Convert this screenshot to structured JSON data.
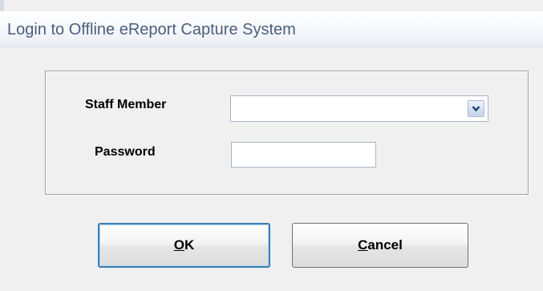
{
  "window": {
    "title": "Login to Offline eReport Capture System"
  },
  "form": {
    "staff_label": "Staff Member",
    "staff_value": "",
    "password_label": "Password",
    "password_value": ""
  },
  "buttons": {
    "ok": {
      "mnemonic": "O",
      "rest": "K"
    },
    "cancel": {
      "mnemonic": "C",
      "rest": "ancel"
    }
  },
  "icons": {
    "dropdown": "chevron-down-icon"
  },
  "colors": {
    "title_text": "#4a5f7d",
    "default_button_border": "#3c7fb1"
  }
}
